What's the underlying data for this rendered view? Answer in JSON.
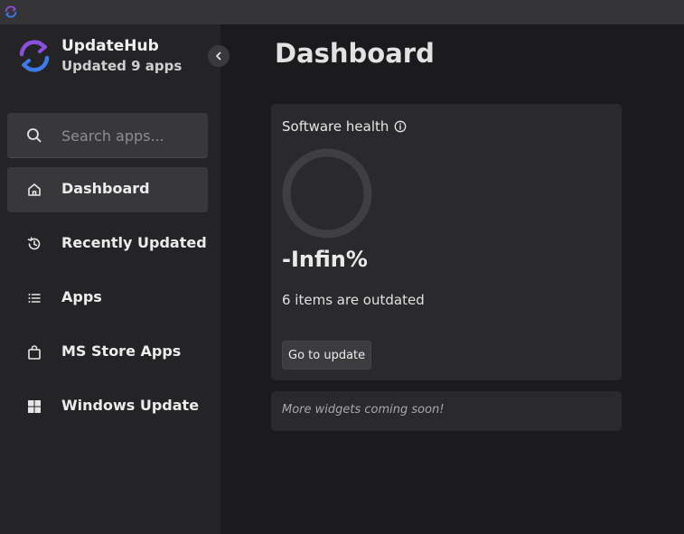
{
  "window": {
    "icon": "sync-icon"
  },
  "sidebar": {
    "brand_name": "UpdateHub",
    "brand_status": "Updated 9 apps",
    "logo_icon": "sync-icon",
    "collapse_icon": "chevron-left-icon",
    "search_placeholder": "Search apps...",
    "search_value": "",
    "items": [
      {
        "label": "Dashboard",
        "icon": "home-icon",
        "active": true
      },
      {
        "label": "Recently Updated",
        "icon": "history-icon",
        "active": false
      },
      {
        "label": "Apps",
        "icon": "list-icon",
        "active": false
      },
      {
        "label": "MS Store Apps",
        "icon": "shopping-bag-icon",
        "active": false
      },
      {
        "label": "Windows Update",
        "icon": "windows-icon",
        "active": false
      }
    ]
  },
  "main": {
    "title": "Dashboard",
    "health_card": {
      "title": "Software health",
      "info_icon": "info-icon",
      "percent": "-Infin%",
      "outdated_text": "6 items are outdated",
      "button_label": "Go to update"
    },
    "more_widgets_text": "More widgets coming soon!"
  },
  "colors": {
    "background": "#1b1b1e",
    "sidebar": "#242427",
    "titlebar": "#353538",
    "card": "#2a2a2d",
    "active_item": "#38383b",
    "logo_blue": "#3d7be8",
    "logo_purple": "#8a4fe0",
    "ring": "#3f3f42"
  }
}
